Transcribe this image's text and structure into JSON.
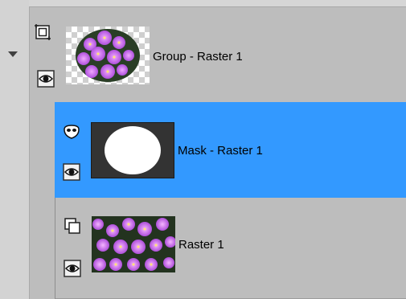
{
  "colors": {
    "panel_bg": "#d6d6d6",
    "row_bg": "#bdbdbd",
    "selected_bg": "#3399ff",
    "text": "#000000"
  },
  "layers": [
    {
      "name": "Group - Raster 1",
      "type_icon": "group-layer-icon",
      "visibility_icon": "eye-icon",
      "expander_icon": "expand-triangle-icon",
      "selected": false
    },
    {
      "name": "Mask - Raster 1",
      "type_icon": "mask-layer-icon",
      "visibility_icon": "eye-icon",
      "selected": true
    },
    {
      "name": "Raster 1",
      "type_icon": "raster-layer-icon",
      "visibility_icon": "eye-icon",
      "selected": false
    }
  ]
}
